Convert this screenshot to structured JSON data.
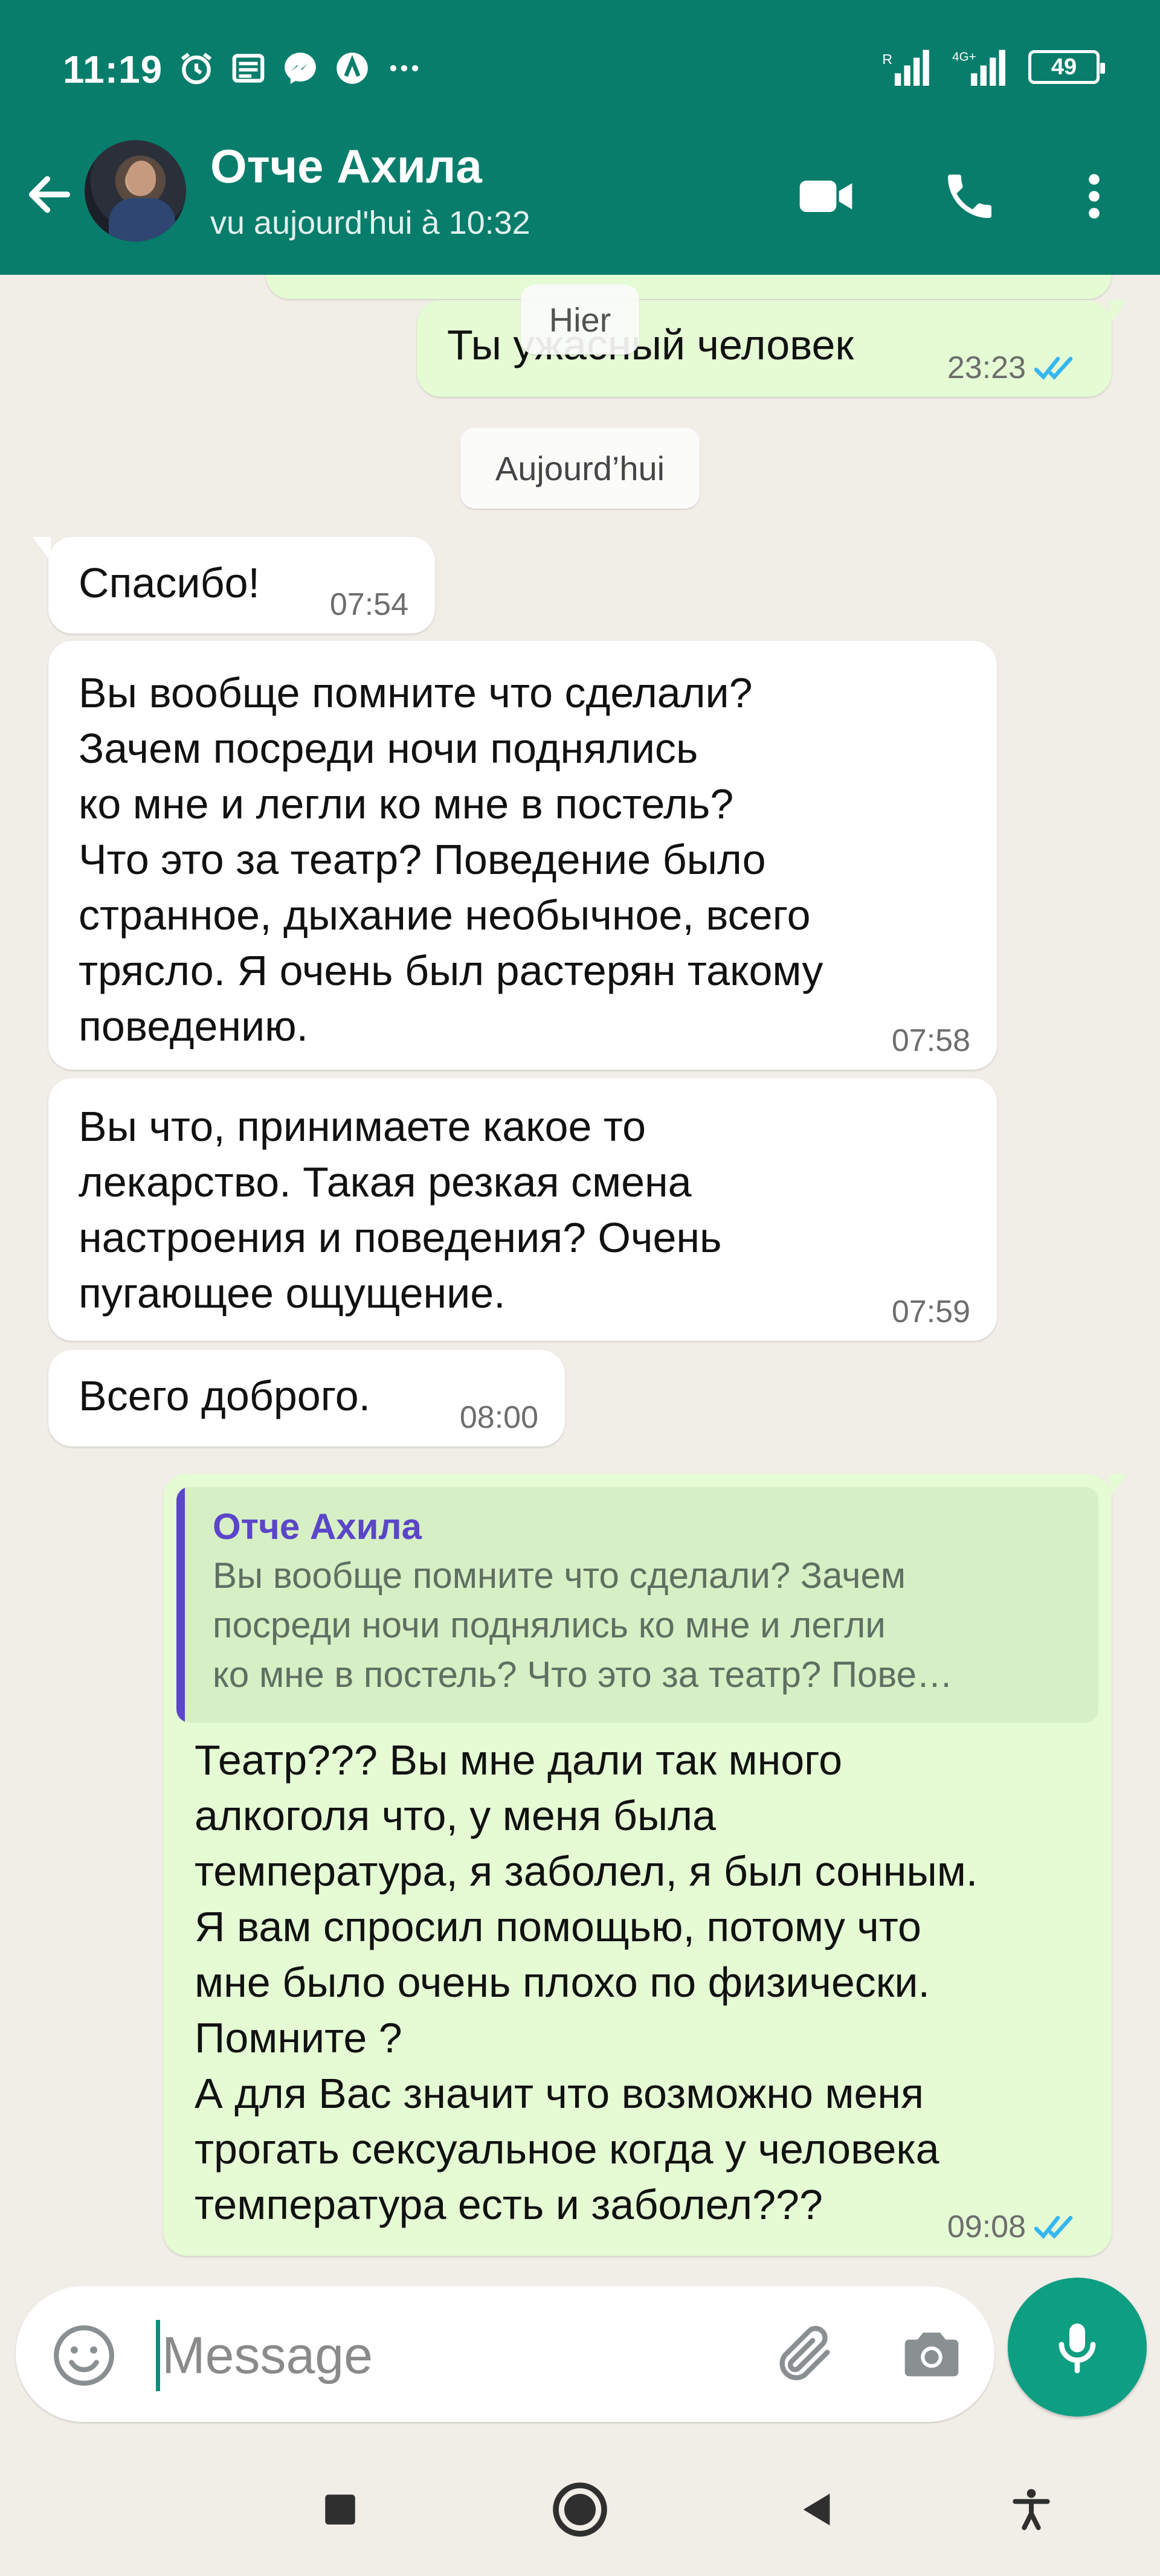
{
  "status_bar": {
    "time": "11:19",
    "signal1": "R",
    "signal2": "4G+",
    "battery": "49"
  },
  "header": {
    "contact_name": "Отче Ахила",
    "last_seen": "vu aujourd'hui à 10:32",
    "icons": [
      "back-arrow-icon",
      "video-call-icon",
      "voice-call-icon",
      "more-options-icon"
    ]
  },
  "chat": {
    "date_yesterday": "Hier",
    "date_today": "Aujourd’hui",
    "messages": [
      {
        "dir": "out",
        "text": "Ты ужасный человек",
        "time": "23:23",
        "read": true
      },
      {
        "dir": "in",
        "text": "Спасибо!",
        "time": "07:54"
      },
      {
        "dir": "in",
        "text": "Вы вообще помните что сделали?\nЗачем посреди ночи поднялись\nко мне и легли ко мне в постель?\nЧто это за театр? Поведение было\nстранное, дыхание необычное, всего\nтрясло. Я очень был растерян такому\nповедению.",
        "time": "07:58"
      },
      {
        "dir": "in",
        "text": "Вы что, принимаете какое то\nлекарство. Такая резкая смена\nнастроения и поведения? Очень\nпугающее ощущение.",
        "time": "07:59"
      },
      {
        "dir": "in",
        "text": "Всего доброго.",
        "time": "08:00"
      },
      {
        "dir": "out",
        "quote_name": "Отче Ахила",
        "quote_text": "Вы вообще помните что сделали? Зачем\nпосреди ночи поднялись ко мне и легли\nко мне в постель? Что это за театр? Пове…",
        "text": "Театр??? Вы мне дали так много\nалкоголя что, у меня была\nтемпература, я заболел, я был сонным.\nЯ вам спросил помощью, потому что\nмне было очень плохо по физически.\nПомните ?\nА для Вас значит что возможно меня\nтрогать сексуальное когда у человека\nтемпература есть и заболел???",
        "time": "09:08",
        "read": true
      }
    ]
  },
  "composer": {
    "placeholder": "Message"
  },
  "colors": {
    "header_bg": "#087d6b",
    "chat_bg": "#f1ede7",
    "outgoing_bubble": "#e4fbd4",
    "incoming_bubble": "#ffffff",
    "read_ticks": "#34b7f1",
    "quote_accent": "#5b45c9",
    "mic_button": "#0e9e82"
  }
}
